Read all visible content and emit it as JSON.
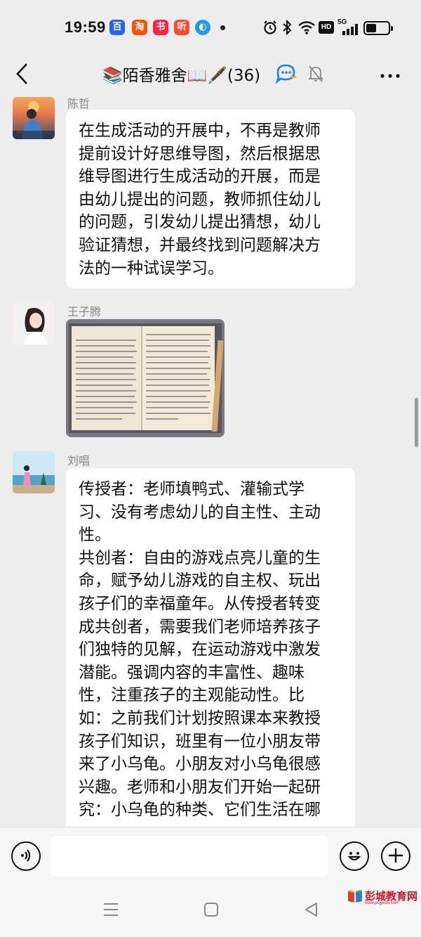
{
  "status_bar": {
    "time": "19:59",
    "app_icons": [
      {
        "name": "baidu-app-icon",
        "glyph": "百",
        "color": "#2a62f0"
      },
      {
        "name": "taobao-app-icon",
        "glyph": "淘",
        "color": "#ff5000"
      },
      {
        "name": "xiaohongshu-app-icon",
        "glyph": "书",
        "color": "#ff2442"
      },
      {
        "name": "ting-app-icon",
        "glyph": "听",
        "color": "#ff4b2b"
      },
      {
        "name": "browser-app-icon",
        "glyph": "◐",
        "color": "#1e9bf0"
      }
    ],
    "signal_label": "5G",
    "hd_label": "HD",
    "battery_level": 0.45
  },
  "header": {
    "title": "📚陌香雅舍📖🖋️(36)",
    "back_icon": "chevron-left-icon",
    "more_icon": "more-dots-icon"
  },
  "messages": [
    {
      "sender": "陈哲",
      "type": "text",
      "lines": [
        "在生成活动的开展中，不再是教师",
        "提前设计好思维导图，然后根据思",
        "维导图进行生成活动的开展，而是",
        "由幼儿提出的问题，教师抓住幼儿",
        "的问题，引发幼儿提出猜想，幼儿",
        "验证猜想，并最终找到问题解决方",
        "法的一种试误学习。"
      ]
    },
    {
      "sender": "王子腾",
      "type": "image",
      "image_desc": "handwritten-notebook-photo"
    },
    {
      "sender": "刘唱",
      "type": "text",
      "lines": [
        "传授者：老师填鸭式、灌输式学",
        "习、没有考虑幼儿的自主性、主动",
        "性。",
        "共创者：自由的游戏点亮儿童的生",
        "命，赋予幼儿游戏的自主权、玩出",
        "孩子们的幸福童年。从传授者转变",
        "成共创者，需要我们老师培养孩子",
        "们独特的见解，在运动游戏中激发",
        "潜能。强调内容的丰富性、趣味",
        "性，注重孩子的主观能动性。比",
        "如：之前我们计划按照课本来教授",
        "孩子们知识，班里有一位小朋友带",
        "来了小乌龟。小朋友对小乌龟很感",
        "兴趣。老师和小朋友们开始一起研",
        "究：小乌龟的种类、它们生活在哪"
      ]
    }
  ],
  "input_bar": {
    "voice_icon": "voice-icon",
    "emoji_icon": "emoji-icon",
    "plus_icon": "plus-icon",
    "value": ""
  },
  "watermark": {
    "text": "彭城教育网",
    "sub": "www.pcjyedu.com"
  }
}
